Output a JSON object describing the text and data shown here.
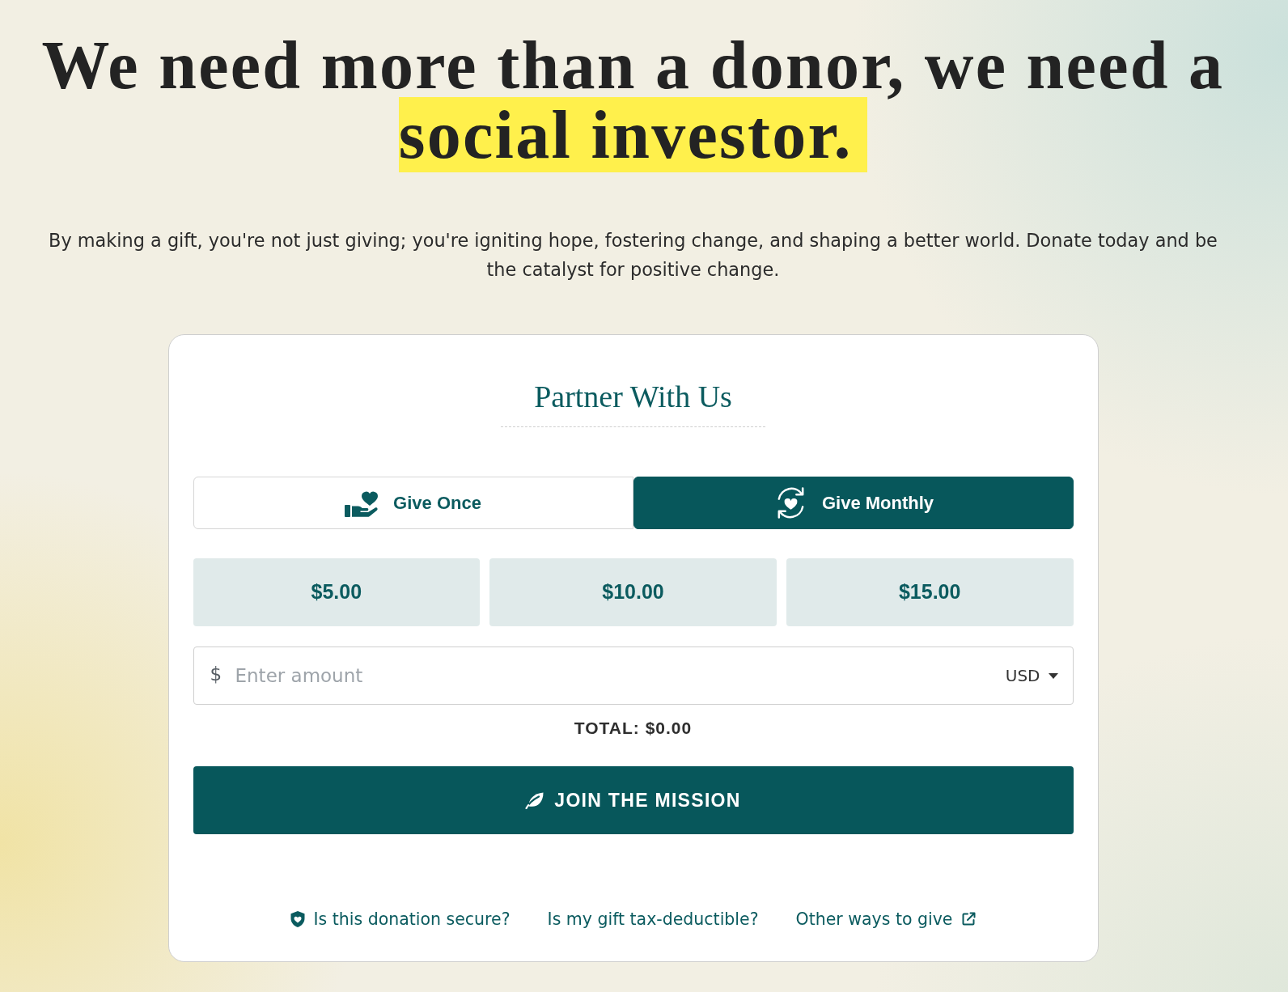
{
  "headline": {
    "text": "We need more than a donor, we need a",
    "highlighted_text": "social investor."
  },
  "intro": "By making a gift, you're not just giving; you're igniting hope, fostering change, and shaping a better world. Donate today and be the catalyst for positive change.",
  "donation_form": {
    "title": "Partner With Us",
    "frequency_tabs": [
      {
        "label": "Give Once",
        "kind": "once",
        "selected": false
      },
      {
        "label": "Give Monthly",
        "kind": "monthly",
        "selected": true
      }
    ],
    "preset_amounts": [
      {
        "label": "$5.00",
        "selected": false
      },
      {
        "label": "$10.00",
        "selected": false
      },
      {
        "label": "$15.00",
        "selected": false
      }
    ],
    "amount_field": {
      "prefix": "$",
      "placeholder": "Enter amount",
      "currency": "USD"
    },
    "total": "TOTAL: $0.00",
    "submit_button": "JOIN THE MISSION",
    "links": [
      {
        "label": "Is this donation secure?",
        "kind": "secure"
      },
      {
        "label": "Is my gift tax-deductible?",
        "kind": "plain"
      },
      {
        "label": "Other ways to give",
        "kind": "external"
      }
    ]
  }
}
